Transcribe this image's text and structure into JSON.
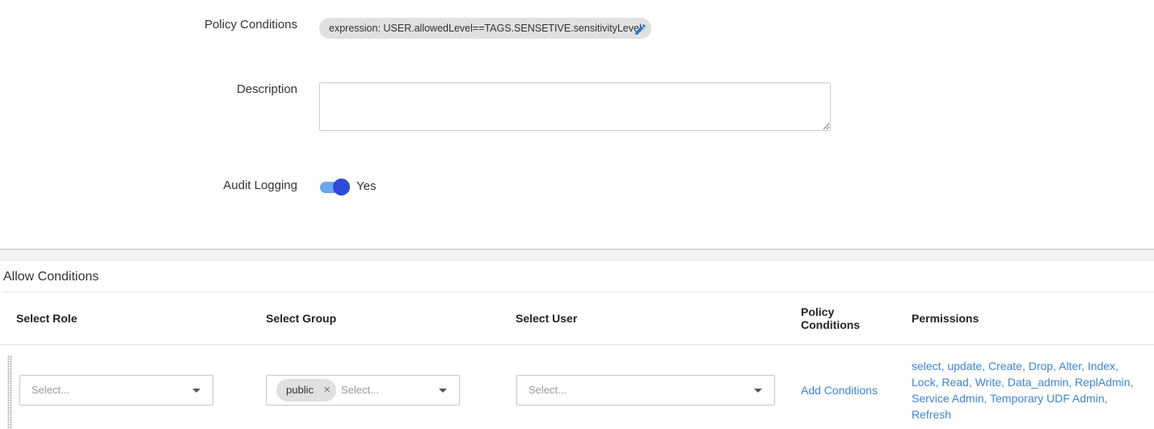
{
  "policy_conditions": {
    "label": "Policy Conditions",
    "expression": "expression: USER.allowedLevel==TAGS.SENSETIVE.sensitivityLevel",
    "edit_icon": "pencil-icon"
  },
  "description": {
    "label": "Description",
    "value": ""
  },
  "audit_logging": {
    "label": "Audit Logging",
    "toggle_on": true,
    "toggle_text": "Yes"
  },
  "allow_conditions": {
    "title": "Allow Conditions",
    "columns": {
      "role": "Select Role",
      "group": "Select Group",
      "user": "Select User",
      "policy_conditions_line1": "Policy",
      "policy_conditions_line2": "Conditions",
      "permissions": "Permissions"
    },
    "row": {
      "role_placeholder": "Select...",
      "group_tag": "public",
      "group_placeholder": "Select...",
      "user_placeholder": "Select...",
      "add_conditions": "Add Conditions",
      "permissions_lines": [
        "select, update, Create, Drop, Alter, Index,",
        "Lock, Read, Write, Data_admin, ReplAdmin,",
        "Service Admin, Temporary UDF Admin,",
        "Refresh"
      ]
    }
  },
  "colors": {
    "accent_link": "#3d85d8",
    "toggle_knob": "#2f4bd8",
    "toggle_track": "#6aa6f0"
  }
}
